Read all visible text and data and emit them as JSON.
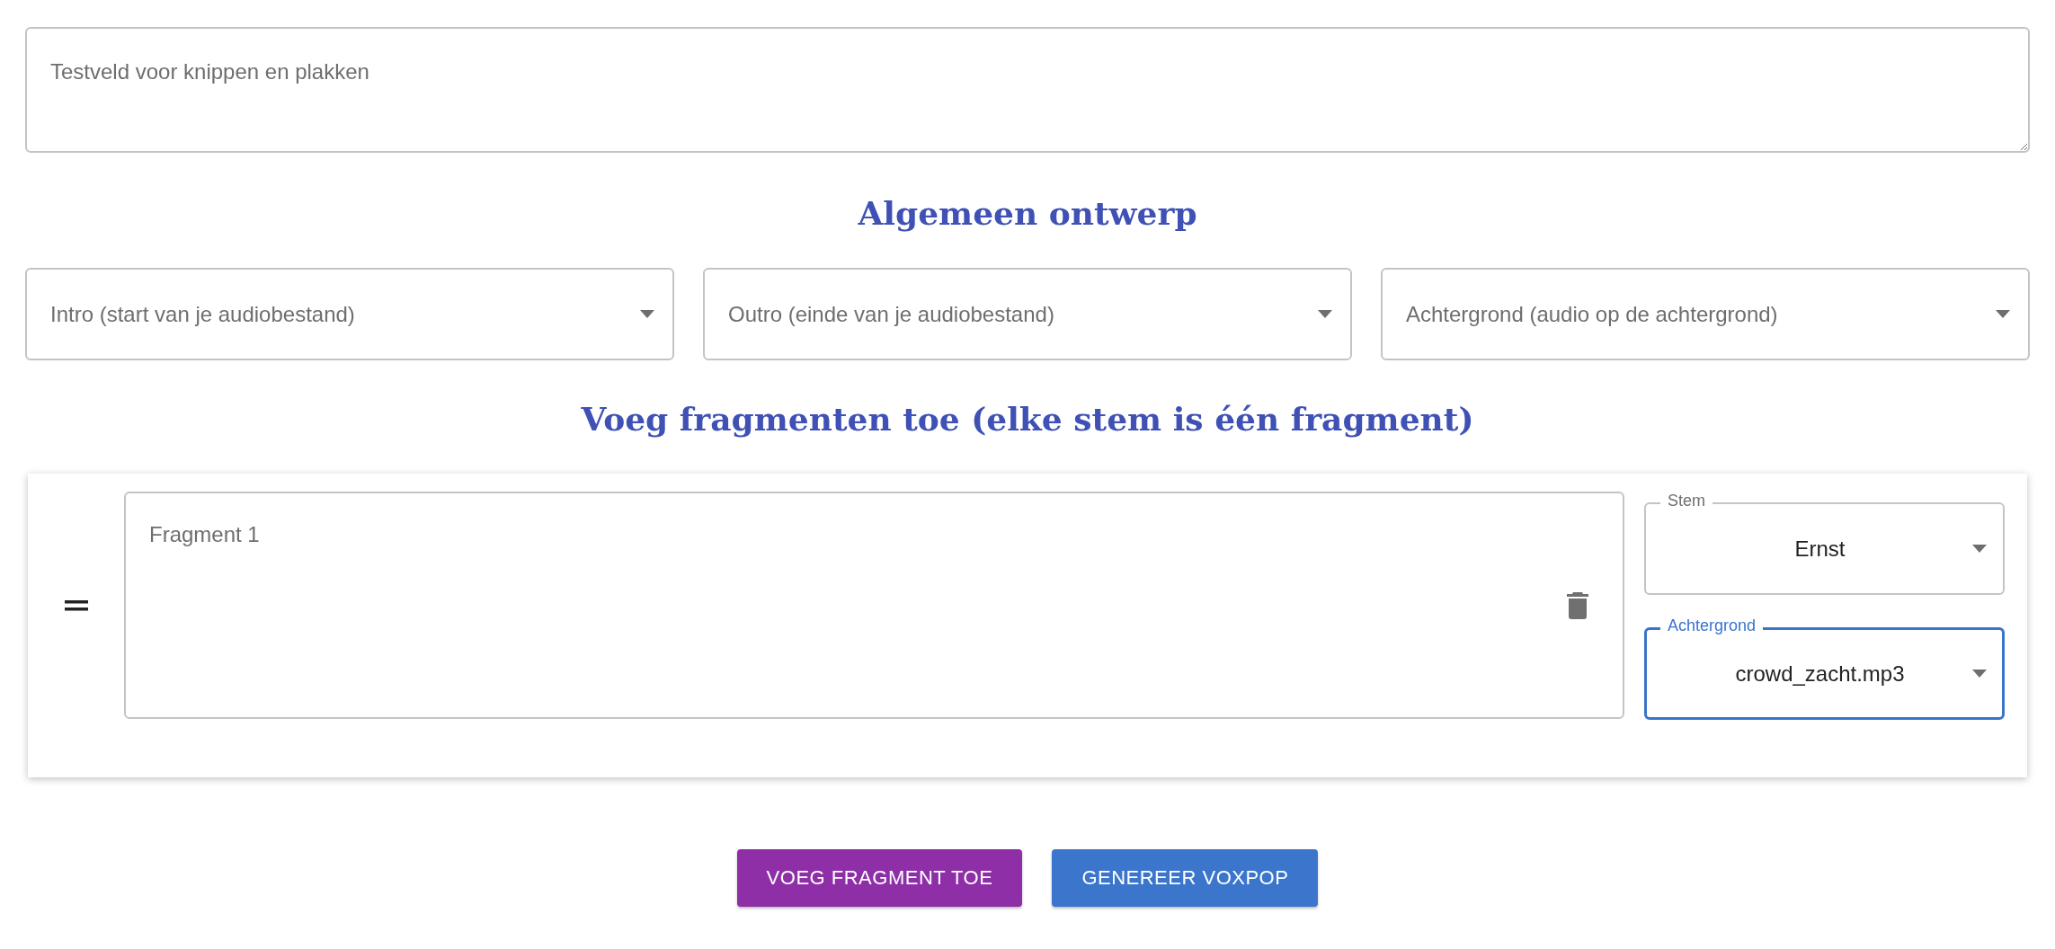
{
  "test_field": {
    "placeholder": "Testveld voor knippen en plakken"
  },
  "general_heading": "Algemeen ontwerp",
  "general_selects": [
    {
      "placeholder": "Intro (start van je audiobestand)"
    },
    {
      "placeholder": "Outro (einde van je audiobestand)"
    },
    {
      "placeholder": "Achtergrond (audio op de achtergrond)"
    }
  ],
  "fragments_heading": "Voeg fragmenten toe (elke stem is één fragment)",
  "fragments": [
    {
      "placeholder": "Fragment 1",
      "selects": [
        {
          "label": "Stem",
          "value": "Ernst",
          "focused": false
        },
        {
          "label": "Achtergrond",
          "value": "crowd_zacht.mp3",
          "focused": true
        }
      ]
    }
  ],
  "buttons": [
    {
      "label": "VOEG FRAGMENT TOE",
      "kind": "secondary"
    },
    {
      "label": "GENEREER VOXPOP",
      "kind": "primary"
    }
  ]
}
